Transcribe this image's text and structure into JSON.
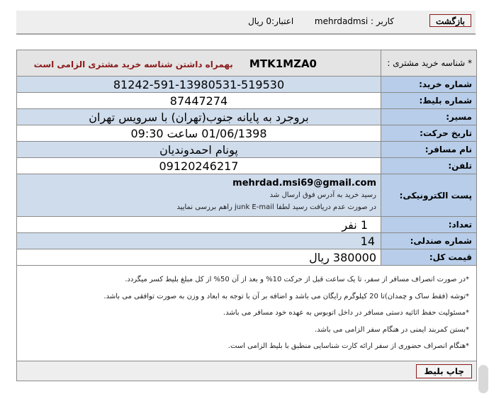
{
  "header": {
    "back_label": "بازگشت",
    "user_label": "کاربر :",
    "username": "mehrdadmsi",
    "credit_label": "اعتبار:0 ریال"
  },
  "ticket": {
    "customer_id_label": "* شناسه خرید مشتری :",
    "customer_id_code": "MTK1MZA0",
    "customer_id_note": "بهمراه داشتن شناسه خرید مشتری الزامی است",
    "purchase_no_label": "شماره خرید:",
    "purchase_no": "81242-591-13980531-519530",
    "ticket_no_label": "شماره بلیط:",
    "ticket_no": "87447274",
    "route_label": "مسیر:",
    "route": "بروجرد به پایانه جنوب(تهران) با سرویس تهران",
    "date_label": "تاریخ حرکت:",
    "date": "01/06/1398 ساعت 09:30",
    "passenger_label": "نام مسافر:",
    "passenger": "پونام احمدوندیان",
    "phone_label": "تلفن:",
    "phone": "09120246217",
    "email_label": "پست الکترونیکی:",
    "email": "mehrdad.msi69@gmail.com",
    "email_note1": "رسید خرید به آدرس فوق ارسال شد",
    "email_note2": "در صورت عدم دریافت رسید لطفا junk E-mail راهم بررسی نمایید",
    "count_label": "تعداد:",
    "count": "1 نفر",
    "seat_label": "شماره صندلی:",
    "seat": "14",
    "price_label": "قیمت کل:",
    "price": "380000 ریال"
  },
  "notes": [
    "*در صورت انصراف مسافر از سفر، تا یک ساعت قبل از حرکت 10% و بعد از آن 50% از کل مبلغ بلیط کسر میگردد.",
    "*توشه (فقط ساک و چمدان)تا 20 کیلوگرم رایگان می باشد و اضافه بر آن با توجه به ابعاد و وزن به صورت توافقی می باشد.",
    "*مسئولیت حفظ اثاثیه دستی مسافر در داخل اتوبوس به عهده خود مسافر می باشد.",
    "*بستن کمربند ایمنی در هنگام سفر الزامی می باشد.",
    "*هنگام انصراف حضوری از سفر ارائه کارت شناسایی منطبق با بلیط الزامی است."
  ],
  "footer": {
    "print_label": "چاپ بلیط"
  }
}
